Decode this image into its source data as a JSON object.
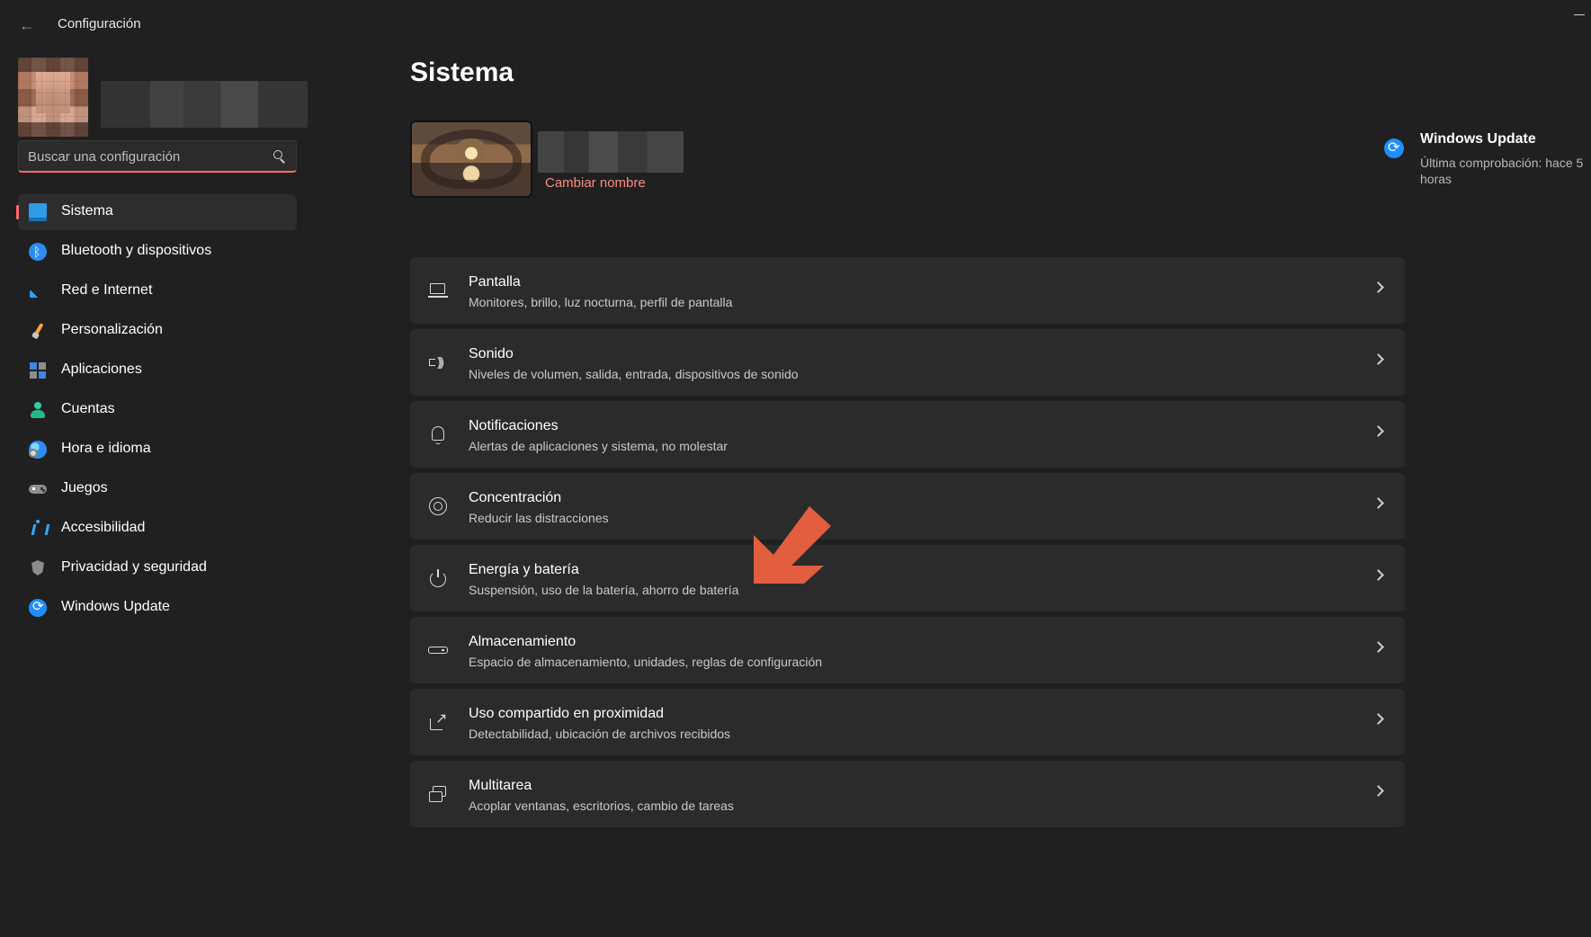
{
  "window": {
    "title": "Configuración"
  },
  "search": {
    "placeholder": "Buscar una configuración"
  },
  "sidebar": {
    "items": [
      {
        "label": "Sistema",
        "icon": "display-icon",
        "active": true
      },
      {
        "label": "Bluetooth y dispositivos",
        "icon": "bluetooth-icon"
      },
      {
        "label": "Red e Internet",
        "icon": "wifi-icon"
      },
      {
        "label": "Personalización",
        "icon": "brush-icon"
      },
      {
        "label": "Aplicaciones",
        "icon": "apps-icon"
      },
      {
        "label": "Cuentas",
        "icon": "user-icon"
      },
      {
        "label": "Hora e idioma",
        "icon": "globe-clock-icon"
      },
      {
        "label": "Juegos",
        "icon": "gamepad-icon"
      },
      {
        "label": "Accesibilidad",
        "icon": "accessibility-icon"
      },
      {
        "label": "Privacidad y seguridad",
        "icon": "shield-icon"
      },
      {
        "label": "Windows Update",
        "icon": "update-icon"
      }
    ]
  },
  "main": {
    "title": "Sistema",
    "device": {
      "rename": "Cambiar nombre"
    },
    "windows_update": {
      "title": "Windows Update",
      "subtitle": "Última comprobación: hace 5 horas"
    },
    "settings": [
      {
        "title": "Pantalla",
        "description": "Monitores, brillo, luz nocturna, perfil de pantalla",
        "icon": "display-icon"
      },
      {
        "title": "Sonido",
        "description": "Niveles de volumen, salida, entrada, dispositivos de sonido",
        "icon": "sound-icon"
      },
      {
        "title": "Notificaciones",
        "description": "Alertas de aplicaciones y sistema, no molestar",
        "icon": "bell-icon"
      },
      {
        "title": "Concentración",
        "description": "Reducir las distracciones",
        "icon": "focus-icon"
      },
      {
        "title": "Energía y batería",
        "description": "Suspensión, uso de la batería, ahorro de batería",
        "icon": "power-icon"
      },
      {
        "title": "Almacenamiento",
        "description": "Espacio de almacenamiento, unidades, reglas de configuración",
        "icon": "storage-icon"
      },
      {
        "title": "Uso compartido en proximidad",
        "description": "Detectabilidad, ubicación de archivos recibidos",
        "icon": "share-icon"
      },
      {
        "title": "Multitarea",
        "description": "Acoplar ventanas, escritorios, cambio de tareas",
        "icon": "multitask-icon"
      }
    ]
  },
  "colors": {
    "background": "#202020",
    "panel": "#2b2b2b",
    "accent": "#ff6b6b",
    "link": "#ff8a80",
    "arrow": "#e35d3f"
  }
}
